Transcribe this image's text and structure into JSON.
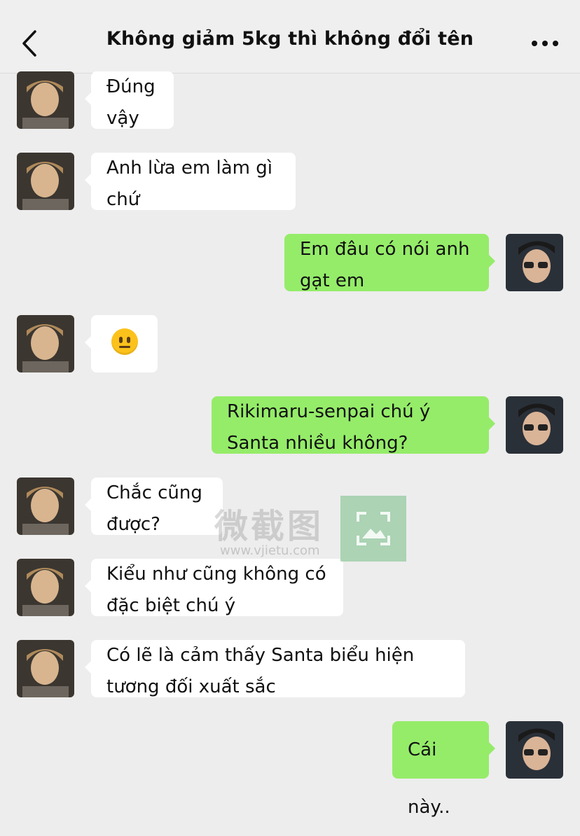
{
  "header": {
    "title": "Không giảm 5kg thì không đổi tên"
  },
  "messages": [
    {
      "side": "left",
      "text": "Đúng vậy"
    },
    {
      "side": "left",
      "text": "Anh lừa em làm gì chứ"
    },
    {
      "side": "right",
      "text": "Em đâu có nói anh gạt em"
    },
    {
      "side": "left",
      "text": "",
      "emoji": "neutral-face"
    },
    {
      "side": "right",
      "text": "Rikimaru-senpai chú ý Santa nhiều không?"
    },
    {
      "side": "left",
      "text": "Chắc cũng được?"
    },
    {
      "side": "left",
      "text": "Kiểu như cũng không có đặc biệt chú ý"
    },
    {
      "side": "left",
      "text": "Có lẽ là cảm thấy Santa biểu hiện tương đối xuất sắc"
    },
    {
      "side": "right",
      "text": "Cái này.."
    }
  ],
  "watermark": {
    "text": "微截图",
    "url": "www.vjietu.com"
  },
  "colors": {
    "background": "#ededed",
    "bubble_left": "#ffffff",
    "bubble_right": "#95ec69"
  }
}
